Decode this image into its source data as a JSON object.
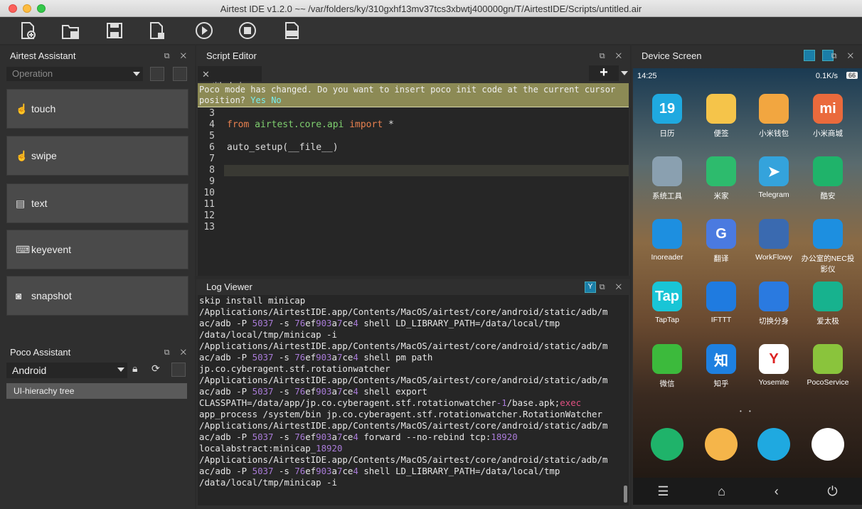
{
  "window": {
    "title": "Airtest IDE v1.2.0 ~~ /var/folders/ky/310gxhf13mv37tcs3xbwtj400000gn/T/AirtestIDE/Scripts/untitled.air"
  },
  "toolbar": {
    "items": [
      "new-script-icon",
      "open-folder-icon",
      "save-icon",
      "save-as-icon",
      "run-icon",
      "stop-icon",
      "log-icon"
    ]
  },
  "assistant": {
    "title": "Airtest Assistant",
    "select_value": "Operation",
    "ops": [
      "touch",
      "swipe",
      "text",
      "keyevent",
      "snapshot"
    ]
  },
  "poco": {
    "title": "Poco Assistant",
    "select_value": "Android",
    "tree_item": "UI-hierachy tree"
  },
  "editor": {
    "title": "Script Editor",
    "tab": "untitled.air",
    "plus": "+",
    "notice": "Poco mode has changed. Do you want to insert poco init code at the current cursor position?",
    "yes": "Yes",
    "no": "No",
    "line_numbers": [
      "3",
      "4",
      "5",
      "6",
      "7",
      "8",
      "9",
      "10",
      "11",
      "12",
      "13"
    ],
    "code": {
      "from": "from",
      "module": "airtest.core.api",
      "import": "import",
      "star": "*",
      "setup": "auto_setup(__file__)"
    }
  },
  "log": {
    "title": "Log Viewer"
  },
  "device": {
    "title": "Device Screen",
    "time": "14:25",
    "net": "0.1K/s",
    "battery": "66",
    "apps": [
      {
        "label": "日历",
        "glyph": "19",
        "color": "#1fa9e0"
      },
      {
        "label": "便签",
        "glyph": "",
        "color": "#f5c44a"
      },
      {
        "label": "小米钱包",
        "glyph": "",
        "color": "#f2a640"
      },
      {
        "label": "小米商城",
        "glyph": "mi",
        "color": "#ea6a3c"
      },
      {
        "label": "系统工具",
        "glyph": "",
        "color": "#8aa0b0"
      },
      {
        "label": "米家",
        "glyph": "",
        "color": "#2dbb6d"
      },
      {
        "label": "Telegram",
        "glyph": "➤",
        "color": "#34a3dc"
      },
      {
        "label": "酷安",
        "glyph": "",
        "color": "#1fb36a"
      },
      {
        "label": "Inoreader",
        "glyph": "",
        "color": "#1d8fe0"
      },
      {
        "label": "翻译",
        "glyph": "G",
        "color": "#4a7ae0"
      },
      {
        "label": "WorkFlowy",
        "glyph": "",
        "color": "#3a6ab0"
      },
      {
        "label": "办公室的NEC投影仪",
        "glyph": "",
        "color": "#1d8fe0"
      },
      {
        "label": "TapTap",
        "glyph": "Tap",
        "color": "#19c5d6"
      },
      {
        "label": "IFTTT",
        "glyph": "",
        "color": "#1f7be0"
      },
      {
        "label": "切换分身",
        "glyph": "",
        "color": "#2a7ae0"
      },
      {
        "label": "爱太极",
        "glyph": "",
        "color": "#17b28e"
      },
      {
        "label": "微信",
        "glyph": "",
        "color": "#3cba3c"
      },
      {
        "label": "知乎",
        "glyph": "知",
        "color": "#1e80e0"
      },
      {
        "label": "Yosemite",
        "glyph": "Y",
        "color": "#ffffff"
      },
      {
        "label": "PocoService",
        "glyph": "",
        "color": "#8ac43c"
      }
    ],
    "dock": [
      {
        "glyph": "",
        "color": "#1fb36a"
      },
      {
        "glyph": "",
        "color": "#f5b54a"
      },
      {
        "glyph": "",
        "color": "#1fa9e0"
      },
      {
        "glyph": "",
        "color": "#ffffff"
      }
    ]
  }
}
